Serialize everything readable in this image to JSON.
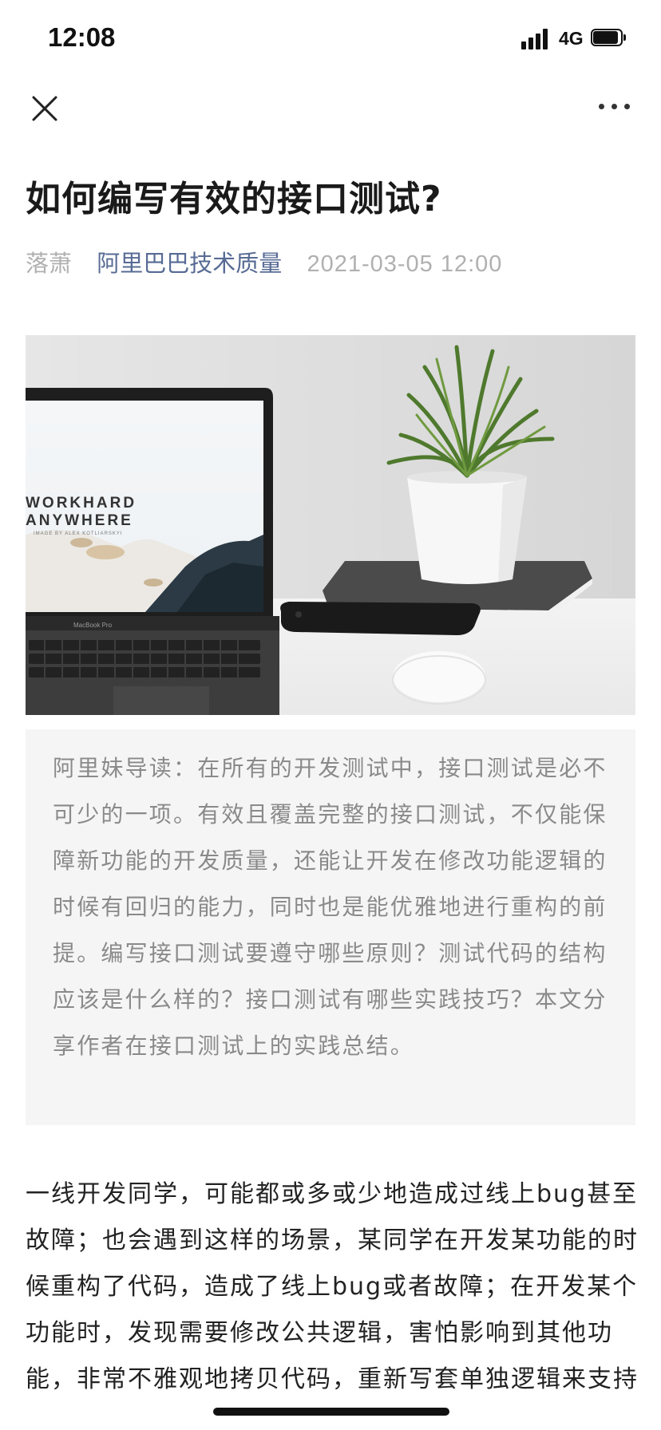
{
  "status_bar": {
    "time": "12:08",
    "network": "4G"
  },
  "nav": {
    "close_icon": "close-icon",
    "more_icon": "more-icon"
  },
  "article": {
    "title": "如何编写有效的接口测试?",
    "author": "落萧",
    "account": "阿里巴巴技术质量",
    "date": "2021-03-05 12:00",
    "cover_image": {
      "screen_line1": "WORKHARD",
      "screen_line2": "ANYWHERE",
      "screen_credit": "IMAGE BY ALEX KOTLIARSKYI",
      "laptop_brand": "MacBook Pro"
    },
    "summary": "阿里妹导读：在所有的开发测试中，接口测试是必不可少的一项。有效且覆盖完整的接口测试，不仅能保障新功能的开发质量，还能让开发在修改功能逻辑的时候有回归的能力，同时也是能优雅地进行重构的前提。编写接口测试要遵守哪些原则？测试代码的结构应该是什么样的？接口测试有哪些实践技巧？本文分享作者在接口测试上的实践总结。",
    "body": "一线开发同学，可能都或多或少地造成过线上bug甚至故障；也会遇到这样的场景，某同学在开发某功能的时候重构了代码，造成了线上bug或者故障；在开发某个功能时，发现需要修改公共逻辑，害怕影响到其他功能，非常不雅观地拷贝代码，重新写套单独逻辑来支持"
  },
  "colors": {
    "account_link": "#576b95",
    "meta_gray": "#b0b0b0",
    "summary_bg": "#f5f5f5",
    "summary_text": "#8a8a8a"
  }
}
